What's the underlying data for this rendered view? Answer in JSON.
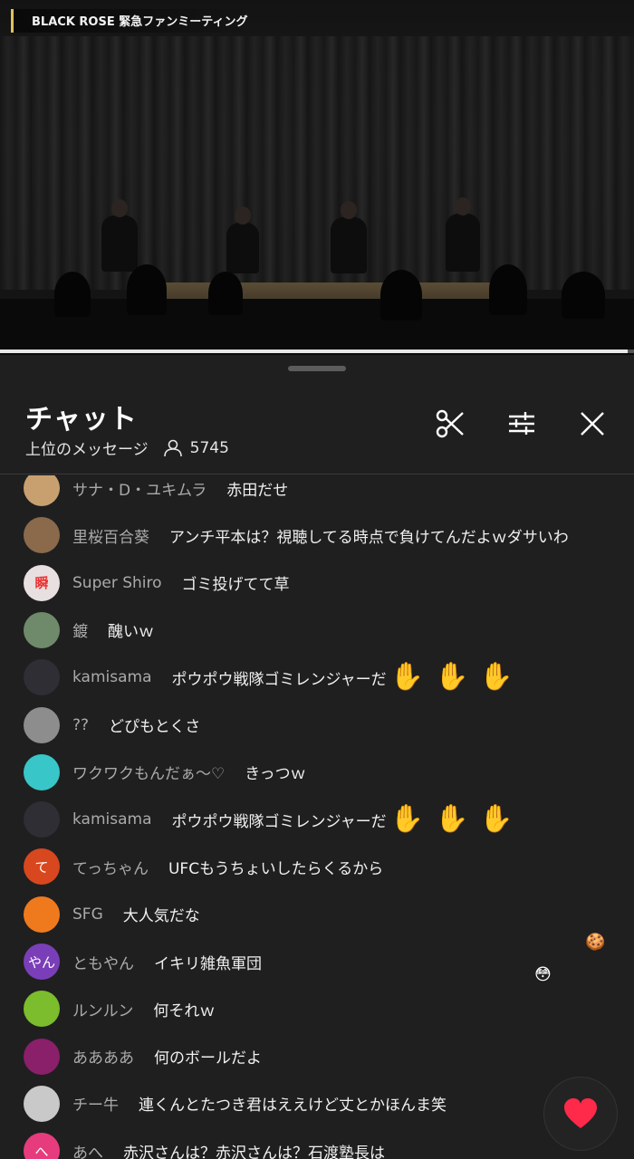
{
  "video": {
    "title": "BLACK ROSE 緊急ファンミーティング",
    "progress_fraction": 0.99
  },
  "chat": {
    "title": "チャット",
    "mode": "上位のメッセージ",
    "viewer_count": "5745",
    "buttons": {
      "scissors": "scissors-icon",
      "filter": "sliders-icon",
      "close": "close-icon"
    }
  },
  "messages": [
    {
      "author": "サナ・D・ユキムラ",
      "text": "赤田だせ",
      "avatar_color": "#c8a070",
      "avatar_text": ""
    },
    {
      "author": "里桜百合葵",
      "text": "アンチ平本は？視聴してる時点で負けてんだよｗダサいわ",
      "avatar_color": "#8a6a4a",
      "avatar_text": ""
    },
    {
      "author": "Super Shiro",
      "text": "ゴミ投げてて草",
      "avatar_color": "#e8e0e0",
      "avatar_text": "瞬"
    },
    {
      "author": "鍍",
      "text": "醜いｗ",
      "avatar_color": "#6f8a6a",
      "avatar_text": ""
    },
    {
      "author": "kamisama",
      "text": "ポウポウ戦隊ゴミレンジャーだ",
      "avatar_color": "#2e2e34",
      "avatar_text": "",
      "emoji": "hands"
    },
    {
      "author": "??",
      "text": "どぴもとくさ",
      "avatar_color": "#8d8d8d",
      "avatar_text": ""
    },
    {
      "author": "ワクワクもんだぁ～♡",
      "text": "きっつｗ",
      "avatar_color": "#38c6c9",
      "avatar_text": ""
    },
    {
      "author": "kamisama",
      "text": "ポウポウ戦隊ゴミレンジャーだ",
      "avatar_color": "#2e2e34",
      "avatar_text": "",
      "emoji": "hands"
    },
    {
      "author": "てっちゃん",
      "text": "UFCもうちょいしたらくるから",
      "avatar_color": "#d9471e",
      "avatar_text": "て"
    },
    {
      "author": "SFG",
      "text": "大人気だな",
      "avatar_color": "#ef7a1d",
      "avatar_text": ""
    },
    {
      "author": "ともやん",
      "text": "イキリ雑魚軍団",
      "avatar_color": "#7a3fb8",
      "avatar_text": "やん"
    },
    {
      "author": "ルンルン",
      "text": "何それｗ",
      "avatar_color": "#7bbd2c",
      "avatar_text": ""
    },
    {
      "author": "ああああ",
      "text": "何のボールだよ",
      "avatar_color": "#8a1f6a",
      "avatar_text": ""
    },
    {
      "author": "チー牛",
      "text": "連くんとたつき君はええけど丈とかほんま笑",
      "avatar_color": "#c9c9c9",
      "avatar_text": ""
    },
    {
      "author": "あへ",
      "text": "赤沢さんは？赤沢さんは？石渡塾長は",
      "avatar_color": "#e63c7d",
      "avatar_text": "へ"
    }
  ],
  "like_button": {
    "icon": "heart-icon",
    "color": "#ff2a4a"
  }
}
